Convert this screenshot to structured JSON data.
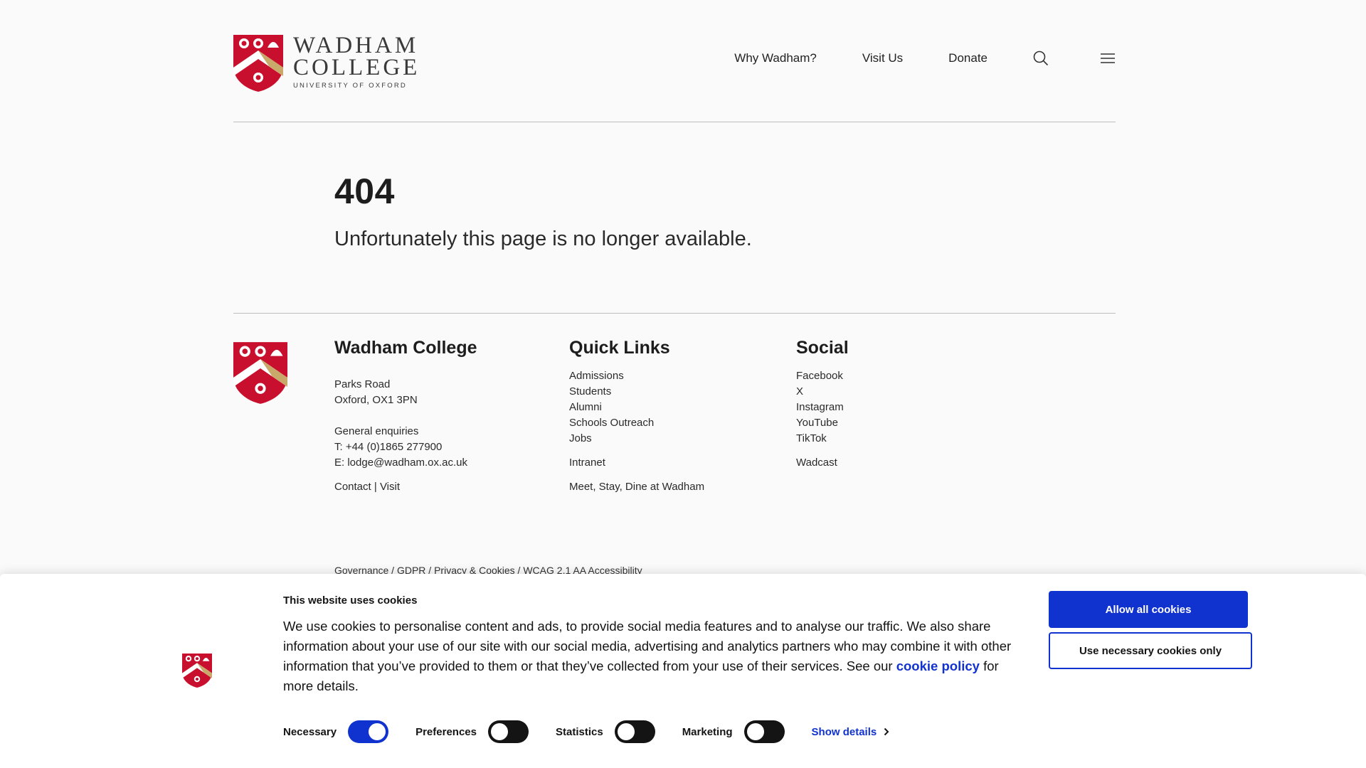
{
  "logo": {
    "line1": "WADHAM",
    "line2": "COLLEGE",
    "line3": "UNIVERSITY OF OXFORD"
  },
  "nav": {
    "items": [
      "Why Wadham?",
      "Visit Us",
      "Donate"
    ],
    "search_icon": "search-icon",
    "menu_icon": "hamburger-menu-icon"
  },
  "main": {
    "code": "404",
    "message": "Unfortunately this page is no longer available."
  },
  "footer": {
    "college": {
      "title": "Wadham College",
      "address1": "Parks Road",
      "address2": "Oxford, OX1 3PN",
      "enquiries": "General enquiries",
      "phone": "T: +44 (0)1865 277900",
      "email": "E: lodge@wadham.ox.ac.uk",
      "contact": "Contact",
      "separator": "|",
      "visit": "Visit"
    },
    "quick_links": {
      "title": "Quick Links",
      "items": [
        "Admissions",
        "Students",
        "Alumni",
        "Schools Outreach",
        "Jobs"
      ],
      "intranet": "Intranet",
      "meet": "Meet, Stay, Dine at Wadham"
    },
    "social": {
      "title": "Social",
      "items": [
        "Facebook",
        "X",
        "Instagram",
        "YouTube",
        "TikTok"
      ],
      "wadcast": "Wadcast"
    },
    "legal": {
      "governance": "Governance",
      "gdpr": "GDPR",
      "privacy": "Privacy & Cookies",
      "wcag": "WCAG 2.1 AA Accessibility",
      "sep": " / "
    }
  },
  "cookie": {
    "title": "This website uses cookies",
    "text": "We use cookies to personalise content and ads, to provide social media features and to analyse our traffic. We also share information about your use of our site with our social media, advertising and analytics partners who may combine it with other information that you’ve provided to them or that they’ve collected from your use of their services. See our",
    "link": "cookie policy",
    "text_after": "for more details.",
    "allow_all": "Allow all cookies",
    "necessary_only": "Use necessary cookies only",
    "toggles": {
      "necessary": "Necessary",
      "preferences": "Preferences",
      "statistics": "Statistics",
      "marketing": "Marketing"
    },
    "show_details": "Show details"
  },
  "colors": {
    "accent": "#1032cf",
    "crest_red": "#c8102e",
    "crest_gold": "#c8a96a"
  }
}
